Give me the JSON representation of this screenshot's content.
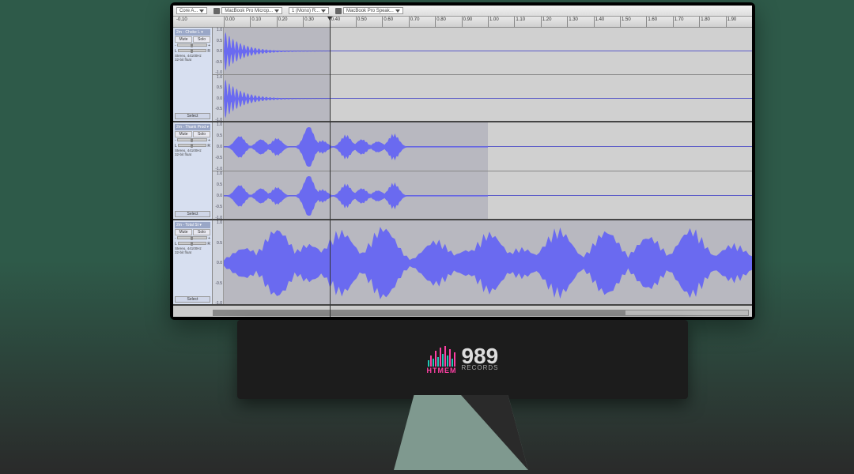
{
  "toolbar": {
    "audio_host_label": "Core A...",
    "input_device_label": "MacBook Pro Microp...",
    "channel_label": "1 (Mono) R...",
    "output_device_label": "MacBook Pro Speak..."
  },
  "ruler": {
    "start_marker": "-0.10",
    "ticks": [
      "0.00",
      "0.10",
      "0.20",
      "0.30",
      "0.40",
      "0.50",
      "0.60",
      "0.70",
      "0.80",
      "0.90",
      "1.00",
      "1.10",
      "1.20",
      "1.30",
      "1.40",
      "1.50",
      "1.60",
      "1.70",
      "1.80",
      "1.90"
    ],
    "playhead_time": 0.4
  },
  "amp_axis": [
    "1.0",
    "0.5",
    "0.0",
    "-0.5",
    "-1.0"
  ],
  "tracks": [
    {
      "name": "2m - Choke L",
      "mute_label": "Mute",
      "solo_label": "Solo",
      "info_line1": "Stereo, 44100Hz",
      "info_line2": "32-bit float",
      "select_label": "Select",
      "clip_end": 0.4,
      "channels": 2,
      "wave_kind": "decay"
    },
    {
      "name": "2m - Thank Prod",
      "mute_label": "Mute",
      "solo_label": "Solo",
      "info_line1": "Stereo, 44100Hz",
      "info_line2": "32-bit float",
      "select_label": "Select",
      "clip_end": 1.0,
      "channels": 2,
      "wave_kind": "sparse"
    },
    {
      "name": "2m - Total St",
      "mute_label": "Mute",
      "solo_label": "Solo",
      "info_line1": "Stereo, 44100Hz",
      "info_line2": "32-bit float",
      "select_label": "Select",
      "clip_end": 2.0,
      "channels": 1,
      "wave_kind": "dense"
    }
  ],
  "logos": {
    "brand1": "HTMEM",
    "brand2_num": "989",
    "brand2_txt": "RECORDS"
  },
  "colors": {
    "wave": "#6a6af0",
    "panel": "#d7dff0"
  }
}
